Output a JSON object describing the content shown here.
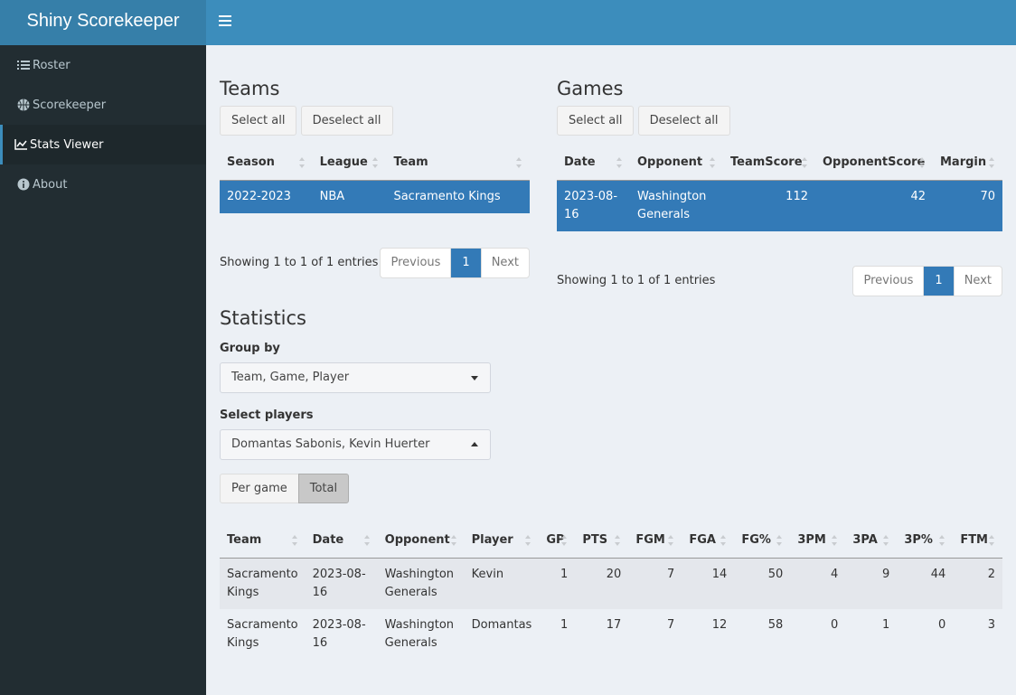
{
  "app": {
    "title": "Shiny Scorekeeper"
  },
  "sidebar": {
    "items": [
      {
        "label": "Roster",
        "icon": "list-icon"
      },
      {
        "label": "Scorekeeper",
        "icon": "basketball-icon"
      },
      {
        "label": "Stats Viewer",
        "icon": "line-chart-icon",
        "active": true
      },
      {
        "label": "About",
        "icon": "info-circle-icon"
      }
    ]
  },
  "teams": {
    "title": "Teams",
    "select_all": "Select all",
    "deselect_all": "Deselect all",
    "columns": [
      "Season",
      "League",
      "Team"
    ],
    "rows": [
      {
        "season": "2022-2023",
        "league": "NBA",
        "team": "Sacramento Kings"
      }
    ],
    "info": "Showing 1 to 1 of 1 entries",
    "pager": {
      "prev": "Previous",
      "page": "1",
      "next": "Next"
    }
  },
  "games": {
    "title": "Games",
    "select_all": "Select all",
    "deselect_all": "Deselect all",
    "columns": [
      "Date",
      "Opponent",
      "TeamScore",
      "OpponentScore",
      "Margin"
    ],
    "rows": [
      {
        "date": "2023-08-16",
        "opponent": "Washington Generals",
        "team_score": "112",
        "opponent_score": "42",
        "margin": "70"
      }
    ],
    "info": "Showing 1 to 1 of 1 entries",
    "pager": {
      "prev": "Previous",
      "page": "1",
      "next": "Next"
    }
  },
  "statistics": {
    "title": "Statistics",
    "group_by_label": "Group by",
    "group_by_value": "Team, Game, Player",
    "players_label": "Select players",
    "players_value": "Domantas Sabonis, Kevin Huerter",
    "toggle": {
      "per_game": "Per game",
      "total": "Total",
      "selected": "total"
    },
    "columns": [
      "Team",
      "Date",
      "Opponent",
      "Player",
      "GP",
      "PTS",
      "FGM",
      "FGA",
      "FG%",
      "3PM",
      "3PA",
      "3P%",
      "FTM"
    ],
    "rows": [
      {
        "team": "Sacramento Kings",
        "date": "2023-08-16",
        "opponent": "Washington Generals",
        "player": "Kevin",
        "gp": "1",
        "pts": "20",
        "fgm": "7",
        "fga": "14",
        "fgp": "50",
        "tpm": "4",
        "tpa": "9",
        "tpp": "44",
        "ftm": "2"
      },
      {
        "team": "Sacramento Kings",
        "date": "2023-08-16",
        "opponent": "Washington Generals",
        "player": "Domantas",
        "gp": "1",
        "pts": "17",
        "fgm": "7",
        "fga": "12",
        "fgp": "58",
        "tpm": "0",
        "tpa": "1",
        "tpp": "0",
        "ftm": "3"
      }
    ]
  },
  "colors": {
    "header": "#3c8dbc",
    "logo": "#367fa9",
    "sidebar": "#222d32",
    "selected_row": "#337ab7",
    "content_bg": "#ecf0f5"
  }
}
